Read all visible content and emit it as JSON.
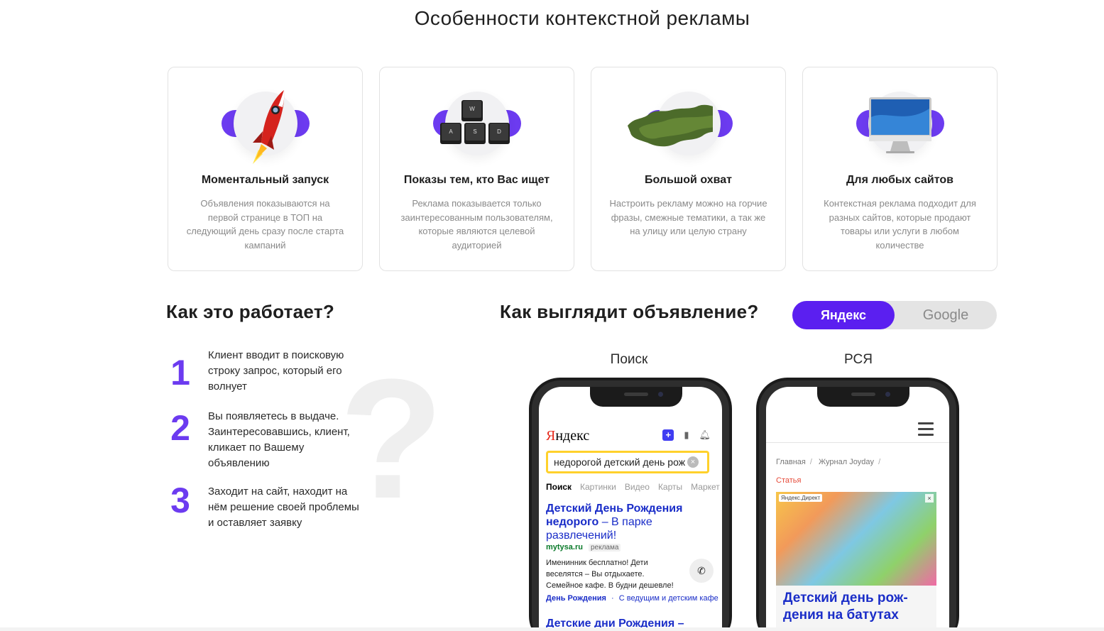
{
  "page_title": "Особенности контекстной рекламы",
  "features": [
    {
      "icon": "rocket-icon",
      "title": "Моментальный запуск",
      "text": "Объявления показываются на первой странице в ТОП на следующий день сразу после старта кампаний"
    },
    {
      "icon": "keyboard-keys-icon",
      "title": "Показы тем, кто Вас ищет",
      "text": "Реклама показывается только заинтересованным пользователям, которые являются целевой аудиторией"
    },
    {
      "icon": "russia-map-icon",
      "title": "Большой охват",
      "text": "Настроить рекламу можно на горчие фразы, смежные тематики, а так же на улицу или целую страну"
    },
    {
      "icon": "monitor-icon",
      "title": "Для любых сайтов",
      "text": "Контекстная реклама подходит для разных сайтов, которые продают товары или услуги в любом количестве"
    }
  ],
  "keyboard_keys": {
    "top": "W",
    "bottom": [
      "A",
      "S",
      "D"
    ]
  },
  "how": {
    "title": "Как это работает?",
    "question_mark": "?",
    "steps": [
      {
        "num": "1",
        "text": "Клиент вводит в поисковую строку запрос, который его волнует"
      },
      {
        "num": "2",
        "text": "Вы появляетесь в выдаче. Заинтересовавшись, клиент, кликает по Вашему объявлению"
      },
      {
        "num": "3",
        "text": "Заходит на сайт, находит на нём решение своей проблемы и оставляет заявку"
      }
    ]
  },
  "look": {
    "title": "Как выглядит объявление?",
    "toggle": {
      "active": "Яндекс",
      "inactive": "Google"
    },
    "search_label": "Поиск",
    "rsya_label": "РСЯ"
  },
  "search_phone": {
    "logo_first": "Я",
    "logo_rest": "ндекс",
    "query": "недорогой детский день рож",
    "clear": "×",
    "tabs": [
      "Поиск",
      "Картинки",
      "Видео",
      "Карты",
      "Маркет"
    ],
    "ad_title_bold": "Детский День Рождения недорого",
    "ad_title_rest": " – В парке развлечений!",
    "ad_url": "mytysa.ru",
    "ad_tag": "реклама",
    "ad_body_1": "Именинник бесплатно! Дети",
    "ad_body_2": "веселятся – Вы отдыхаете.",
    "ad_body_3": "Семейное кафе. В будни дешевле!",
    "ad_links_1": "День Рождения",
    "ad_links_2": "С ведущим и детским кафе",
    "ad2_title": "Детские дни Рождения – Страна KidZania"
  },
  "rsya_phone": {
    "crumbs": [
      "Главная",
      "Журнал Joyday"
    ],
    "article": "Статья",
    "ad_badge": "Яндекс.Директ",
    "ad_close": "×",
    "ad_title": "Детский день рож-дения на батутах"
  },
  "colors": {
    "accent": "#5b1ff0",
    "violet": "#6c3bf0"
  }
}
